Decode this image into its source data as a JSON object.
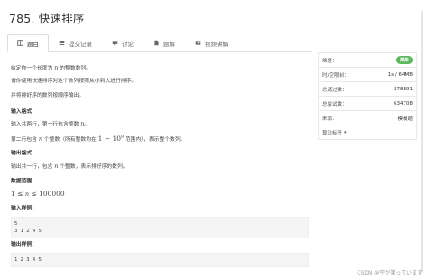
{
  "problem": {
    "title": "785. 快速排序"
  },
  "tabs": [
    {
      "label": "题目",
      "icon": "book-icon",
      "active": true
    },
    {
      "label": "提交记录",
      "icon": "list-icon",
      "active": false
    },
    {
      "label": "讨论",
      "icon": "comment-icon",
      "active": false
    },
    {
      "label": "题解",
      "icon": "file-icon",
      "active": false
    },
    {
      "label": "视频讲解",
      "icon": "video-icon",
      "active": false
    }
  ],
  "statement": {
    "line1_pre": "给定你一个长度为 ",
    "line1_var": "n",
    "line1_post": " 的整数数列。",
    "line2": "请你使用快速排序对这个数列按照从小到大进行排序。",
    "line3": "并将排好序的数列按顺序输出。",
    "input_heading": "输入格式",
    "input_line1_pre": "输入共两行，第一行包含整数 ",
    "input_line1_var": "n",
    "input_line1_post": "。",
    "input_line2_pre": "第二行包含 ",
    "input_line2_var": "n",
    "input_line2_mid": " 个整数（所有整数均在 ",
    "input_line2_range": "1 ∼ 10",
    "input_line2_exp": "9",
    "input_line2_post": " 范围内），表示整个数列。",
    "output_heading": "输出格式",
    "output_line1_pre": "输出共一行，包含 ",
    "output_line1_var": "n",
    "output_line1_post": " 个整数，表示排好序的数列。",
    "range_heading": "数据范围",
    "range_a": "1 ≤ ",
    "range_var": "n",
    "range_b": " ≤ 100000",
    "sample_in_heading": "输入样例：",
    "sample_in_line1": "5",
    "sample_in_line2": "3 1 2 4 5",
    "sample_out_heading": "输出样例：",
    "sample_out_line1": "1 2 3 4 5"
  },
  "info": {
    "difficulty_label": "难度：",
    "difficulty_value": "简单",
    "difficulty_color": "#5cb85c",
    "time_label": "时/空限制：",
    "time_value": "1s / 64MB",
    "pass_label": "总通过数：",
    "pass_value": "278891",
    "try_label": "总尝试数：",
    "try_value": "634708",
    "source_label": "来源：",
    "source_value": "模板题",
    "algo_label": "算法标签"
  },
  "watermark": "CSDN @空が笑っています"
}
